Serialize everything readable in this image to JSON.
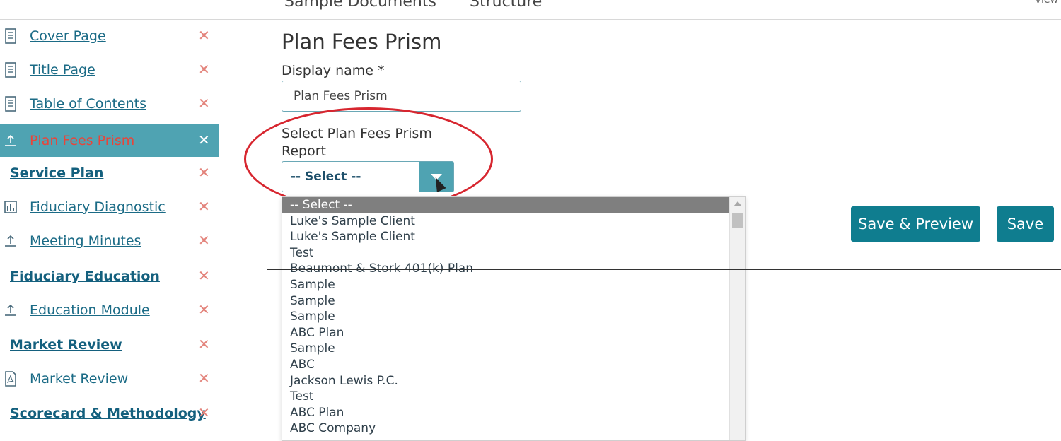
{
  "top_tabs": [
    {
      "label": "Sample Documents"
    },
    {
      "label": "Structure"
    }
  ],
  "top_right": "View",
  "sidebar": {
    "items": [
      {
        "label": "Cover Page",
        "icon": "document-icon",
        "remove": "✕"
      },
      {
        "label": "Title Page",
        "icon": "document-icon",
        "remove": "✕"
      },
      {
        "label": "Table of Contents",
        "icon": "document-icon",
        "remove": "✕"
      },
      {
        "label": "Plan Fees Prism",
        "icon": "upload-icon",
        "remove": "✕",
        "active": true
      },
      {
        "label": "Service Plan",
        "section": true,
        "remove": "✕"
      },
      {
        "label": "Fiduciary Diagnostic",
        "icon": "chart-icon",
        "remove": "✕"
      },
      {
        "label": "Meeting Minutes",
        "icon": "upload-icon",
        "remove": "✕"
      },
      {
        "label": "Fiduciary Education",
        "section": true,
        "remove": "✕"
      },
      {
        "label": "Education Module",
        "icon": "upload-icon",
        "remove": "✕"
      },
      {
        "label": "Market Review",
        "section": true,
        "remove": "✕"
      },
      {
        "label": "Market Review",
        "icon": "pdf-icon",
        "remove": "✕"
      },
      {
        "label": "Scorecard & Methodology",
        "section": true,
        "remove": "✕"
      }
    ]
  },
  "main": {
    "title": "Plan Fees Prism",
    "display_name_label": "Display name *",
    "display_name_value": "Plan Fees Prism",
    "report_label_line1": "Select Plan Fees Prism",
    "report_label_line2": "Report",
    "select_value": "-- Select --",
    "dropdown_options": [
      "-- Select --",
      "Luke's Sample Client",
      "Luke's Sample Client",
      "Test",
      "Beaumont & Stork 401(k) Plan",
      "Sample",
      "Sample",
      "Sample",
      "ABC Plan",
      "Sample",
      "ABC",
      "Jackson Lewis P.C.",
      "Test",
      "ABC Plan",
      "ABC Company"
    ],
    "save_preview_label": "Save & Preview",
    "save_label": "Save"
  },
  "colors": {
    "accent": "#4fa3b2",
    "button": "#0f7d8f",
    "link": "#1b6b86",
    "remove": "#e3837b",
    "highlight": "#d7262f"
  }
}
